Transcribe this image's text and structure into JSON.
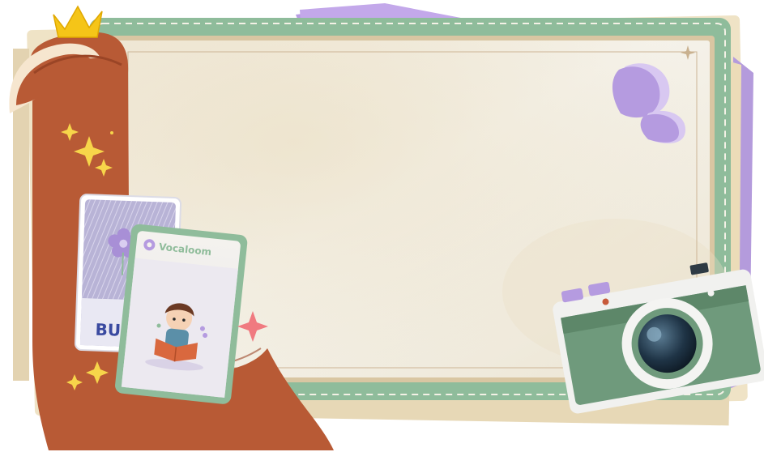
{
  "cards": {
    "front": {
      "brand": "Vocaloom"
    },
    "back": {
      "partial_text": "BU"
    }
  },
  "colors": {
    "frame_green": "#8fbc9b",
    "frame_green_dark": "#6f9e7e",
    "paper": "#f3efe6",
    "ribbon": "#b85a35",
    "ribbon_dark": "#9a4526",
    "lavender": "#b59be0",
    "crown": "#f5c518",
    "camera_body": "#6f9a7c",
    "sparkle_pink": "#f07a80"
  },
  "icons": [
    "crown-icon",
    "sparkle-icon",
    "flower-icon",
    "camera-icon",
    "petal-icon",
    "star-icon"
  ]
}
